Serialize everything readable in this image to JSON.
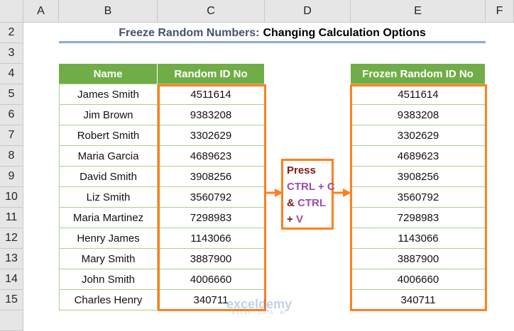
{
  "columns": [
    "A",
    "B",
    "C",
    "D",
    "E",
    "F"
  ],
  "rows": [
    "2",
    "3",
    "4",
    "5",
    "6",
    "7",
    "8",
    "9",
    "10",
    "11",
    "12",
    "13",
    "14",
    "15"
  ],
  "title": {
    "part1": "Freeze Random Numbers:",
    "part2": "Changing Calculation Options"
  },
  "table1": {
    "headers": [
      "Name",
      "Random ID No"
    ],
    "rows": [
      [
        "James Smith",
        "4511614"
      ],
      [
        "Jim Brown",
        "9383208"
      ],
      [
        "Robert Smith",
        "3302629"
      ],
      [
        "Maria Garcia",
        "4689623"
      ],
      [
        "David Smith",
        "3908256"
      ],
      [
        "Liz Smith",
        "3560792"
      ],
      [
        "Maria Martinez",
        "7298983"
      ],
      [
        "Henry James",
        "1143066"
      ],
      [
        "Mary Smith",
        "3887900"
      ],
      [
        "John Smith",
        "4006660"
      ],
      [
        "Charles Henry",
        "340711"
      ]
    ]
  },
  "table2": {
    "header": "Frozen Random ID No",
    "values": [
      "4511614",
      "9383208",
      "3302629",
      "4689623",
      "3908256",
      "3560792",
      "7298983",
      "1143066",
      "3887900",
      "4006660",
      "340711"
    ]
  },
  "note": {
    "l1": "Press",
    "l2a": "CTRL + C",
    "l3a": "& ",
    "l3b": "CTRL",
    "l4a": "+ ",
    "l4b": "V"
  },
  "watermark": {
    "name": "exceldemy",
    "tag": "EXCEL · DATA · BI"
  },
  "colors": {
    "header_green": "#70ad47",
    "orange": "#ff7f1e",
    "purple": "#9b4fa5",
    "maroon": "#7b1a1a"
  }
}
